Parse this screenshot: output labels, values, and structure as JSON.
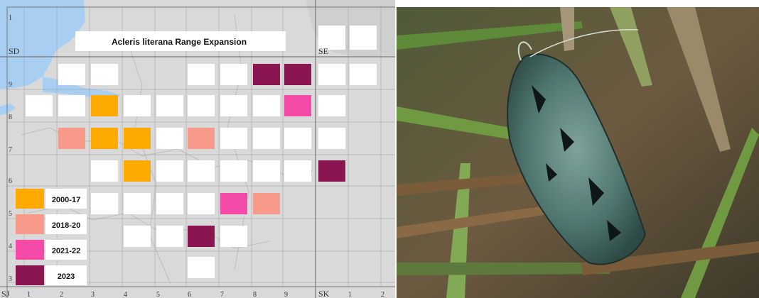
{
  "map": {
    "title": "Acleris literana Range Expansion",
    "legend": [
      {
        "label": "2000-17",
        "color": "#ffaa00"
      },
      {
        "label": "2018-20",
        "color": "#f79a8a"
      },
      {
        "label": "2021-22",
        "color": "#f24aa6"
      },
      {
        "label": "2023",
        "color": "#8a1551"
      }
    ],
    "grid_letters": {
      "top_left": "SD",
      "top_right": "SE",
      "bottom_left": "SJ",
      "bottom_right": "SK"
    },
    "row_numbers": [
      "1",
      "9",
      "8",
      "7",
      "6",
      "5",
      "4",
      "3"
    ],
    "column_numbers": [
      "1",
      "2",
      "3",
      "4",
      "5",
      "6",
      "7",
      "8",
      "9",
      "1",
      "2"
    ],
    "colors": {
      "sea": "#a8cff2",
      "land": "#d9d9d9",
      "empty_square": "#ffffff",
      "grid_line": "#9a9a9a"
    }
  },
  "photo": {
    "subject": "green-grey lichen-patterned moth resting on grass stems"
  }
}
